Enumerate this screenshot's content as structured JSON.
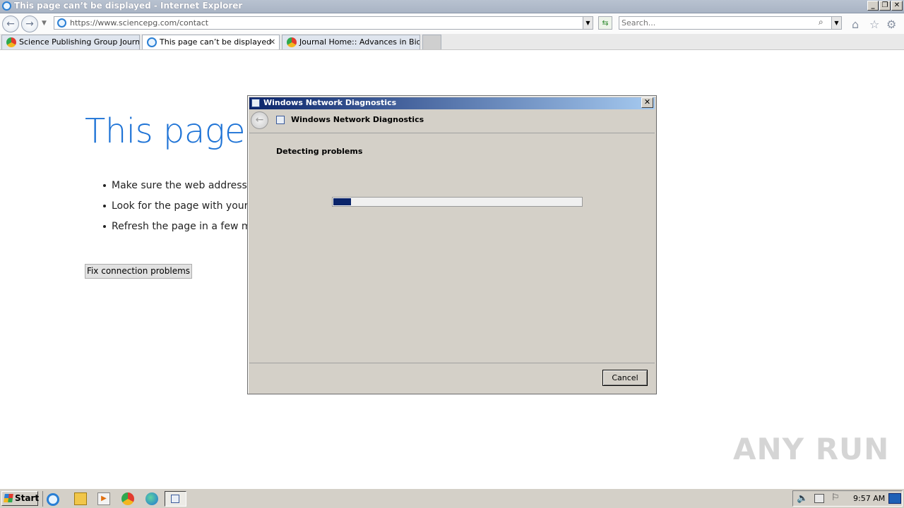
{
  "window": {
    "title": "This page can’t be displayed - Internet Explorer",
    "controls": {
      "minimize": "_",
      "restore": "❐",
      "close": "✕"
    }
  },
  "addressbar": {
    "url": "https://www.sciencepg.com/contact",
    "search_placeholder": "Search..."
  },
  "tabs": [
    {
      "label": "Science Publishing Group Journa...",
      "icon": "science-publishing-favicon",
      "active": false
    },
    {
      "label": "This page can’t be displayed",
      "icon": "ie-icon",
      "active": true
    },
    {
      "label": "Journal Home:: Advances in Bio...",
      "icon": "science-publishing-favicon",
      "active": false
    }
  ],
  "page": {
    "title": "This page c",
    "bullets": [
      "Make sure the web address h",
      "Look for the page with your",
      "Refresh the page in a few mi"
    ],
    "fix_button": "Fix connection problems"
  },
  "dialog": {
    "title": "Windows Network Diagnostics",
    "header": "Windows Network Diagnostics",
    "status": "Detecting problems",
    "progress_fraction": 0.07,
    "cancel": "Cancel"
  },
  "watermark": "ANY RUN",
  "taskbar": {
    "start": "Start",
    "clock": "9:57 AM"
  },
  "colors": {
    "accent_blue": "#1e73d6",
    "dialog_title": "#0a246a",
    "progress_fill": "#0a246a",
    "chrome_gray": "#d4d0c8"
  }
}
